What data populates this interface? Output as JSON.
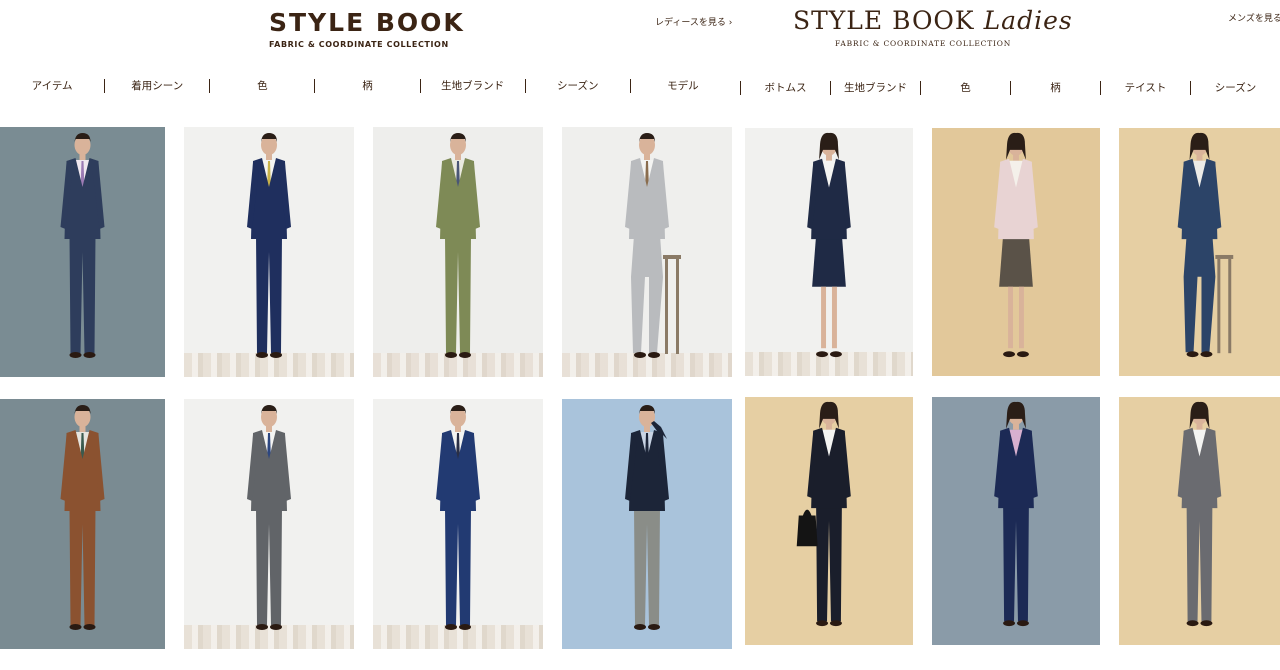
{
  "men": {
    "logo_title": "STYLE BOOK",
    "logo_sub": "FABRIC & COORDINATE COLLECTION",
    "switch_link": "レディースを見る ›",
    "nav": [
      "アイテム",
      "着用シーン",
      "色",
      "柄",
      "生地ブランド",
      "シーズン",
      "モデル"
    ],
    "tiles": [
      {
        "bg": "#7a8c93",
        "jacket": "#2e3d5c",
        "pants": "#2e3d5c",
        "shirt": "#f0e8ef",
        "tie": "#9c7bb4",
        "floor": false,
        "pose": "stand"
      },
      {
        "bg": "#f1f1ef",
        "jacket": "#1f2f5e",
        "pants": "#1f2f5e",
        "shirt": "#f4f4f2",
        "tie": "#c9b34a",
        "floor": true,
        "pose": "stand"
      },
      {
        "bg": "#eeeeec",
        "jacket": "#7e8a56",
        "pants": "#7e8a56",
        "shirt": "#eaeadf",
        "tie": "#4a5676",
        "floor": true,
        "pose": "lean"
      },
      {
        "bg": "#efefed",
        "jacket": "#b9bbbe",
        "pants": "#b9bbbe",
        "shirt": "#f4f4f2",
        "tie": "#8a6d4e",
        "floor": true,
        "pose": "sit"
      },
      {
        "bg": "#7a8b92",
        "jacket": "#8b5230",
        "pants": "#8b5230",
        "shirt": "#e6e4de",
        "tie": "#3a5a4e",
        "floor": false,
        "pose": "stand"
      },
      {
        "bg": "#f1f1ef",
        "jacket": "#616468",
        "pants": "#616468",
        "shirt": "#f4f4f2",
        "tie": "#2d4780",
        "floor": true,
        "pose": "stand"
      },
      {
        "bg": "#f1f1ef",
        "jacket": "#223a72",
        "pants": "#223a72",
        "shirt": "#f4f4f2",
        "tie": "#2a2f45",
        "floor": true,
        "pose": "stand"
      },
      {
        "bg": "#a9c3db",
        "jacket": "#1c2538",
        "pants": "#8a8d88",
        "shirt": "#c9d4e4",
        "tie": "#1c2538",
        "floor": false,
        "pose": "think"
      }
    ]
  },
  "ladies": {
    "logo_title": "STYLE BOOK",
    "logo_title_script": "Ladies",
    "logo_sub": "FABRIC & COORDINATE COLLECTION",
    "switch_link": "メンズを見る ›",
    "nav": [
      "ボトムス",
      "生地ブランド",
      "色",
      "柄",
      "テイスト",
      "シーズン"
    ],
    "tiles": [
      {
        "bg": "#f1f1ef",
        "jacket": "#1f2a45",
        "pants": "#1f2a45",
        "shirt": "#f4f4f2",
        "floor": true,
        "pose": "skirt"
      },
      {
        "bg": "#e2c89a",
        "jacket": "#e8d3d3",
        "pants": "#5a5248",
        "shirt": "#f4f0ea",
        "floor": false,
        "pose": "skirt"
      },
      {
        "bg": "#e6cfa3",
        "jacket": "#2c4468",
        "pants": "#2c4468",
        "shirt": "#ecebe7",
        "floor": false,
        "pose": "sit"
      },
      {
        "bg": "#e6cfa3",
        "jacket": "#1a1e2b",
        "pants": "#1a1e2b",
        "shirt": "#f4f4f2",
        "floor": false,
        "pose": "bag"
      },
      {
        "bg": "#8a9ba8",
        "jacket": "#1c2a55",
        "pants": "#1c2a55",
        "shirt": "#d7b0cf",
        "floor": false,
        "pose": "pants"
      },
      {
        "bg": "#e6cfa3",
        "jacket": "#6a6b70",
        "pants": "#6a6b70",
        "shirt": "#f4f4f2",
        "floor": false,
        "pose": "pants"
      }
    ]
  }
}
